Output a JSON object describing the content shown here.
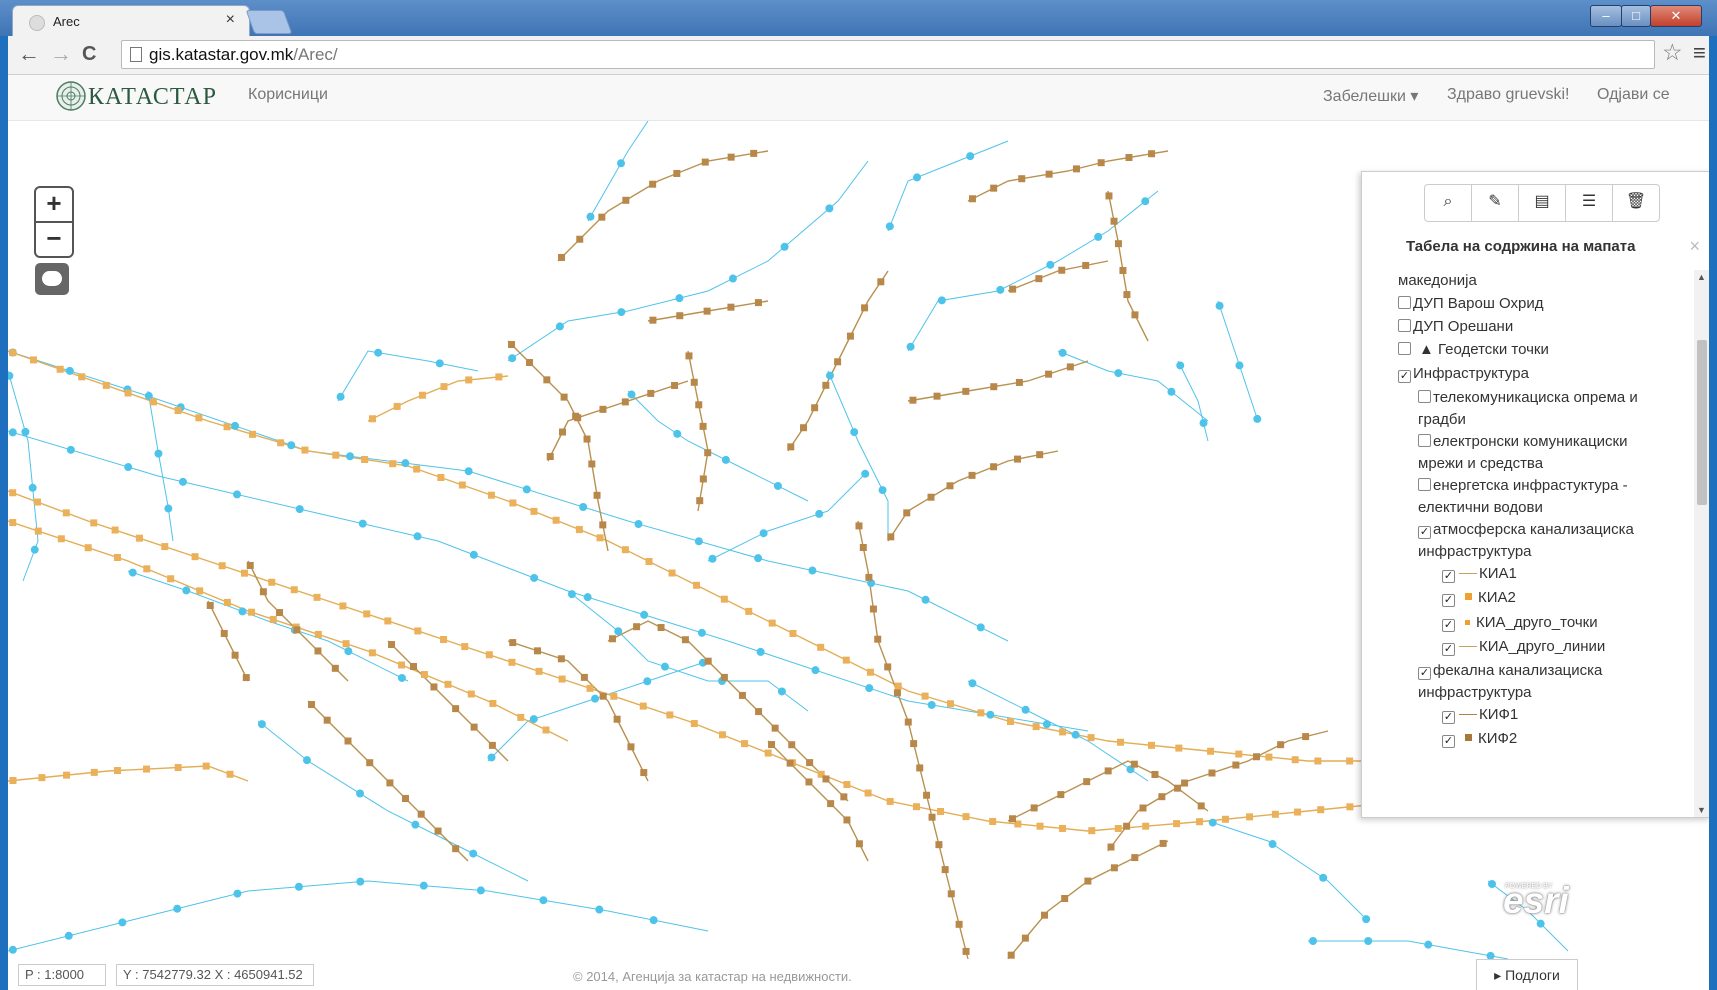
{
  "browser": {
    "tab_title": "Arec",
    "tab_close": "×",
    "url_host": "gis.katastar.gov.mk",
    "url_path": "/Arec/",
    "back": "←",
    "forward": "→",
    "reload": "C",
    "star": "☆",
    "menu": "≡",
    "win_min": "–",
    "win_max": "□",
    "win_close": "✕"
  },
  "navbar": {
    "brand": "КАТАСТАР",
    "users": "Корисници",
    "notes": "Забелешки ▾",
    "hello": "Здраво gruevski!",
    "logout": "Одјави се"
  },
  "zoom": {
    "in": "+",
    "out": "−"
  },
  "toc": {
    "title": "Табела на содржина на мапата",
    "close": "×",
    "buttons": [
      {
        "icon": "search-icon",
        "glyph": "⌕"
      },
      {
        "icon": "pin-icon",
        "glyph": "✎"
      },
      {
        "icon": "legend-icon",
        "glyph": "▤"
      },
      {
        "icon": "list-icon",
        "glyph": "☰"
      },
      {
        "icon": "trash-icon",
        "glyph": "🗑"
      }
    ],
    "items": [
      {
        "label": "македонија",
        "checked": null
      },
      {
        "label": "ДУП Варош Охрид",
        "checked": false
      },
      {
        "label": "ДУП Орешани",
        "checked": false
      },
      {
        "label": "▲ Геодетски точки",
        "checked": false
      },
      {
        "label": "Инфраструктура",
        "checked": true
      },
      {
        "label": "телекомуникациска опрема и",
        "label2": "градби",
        "checked": false
      },
      {
        "label": "електронски комуникациски",
        "label2": "мрежи и средства",
        "checked": false
      },
      {
        "label": "енергетска инфрастуктура -",
        "label2": "електични водови",
        "checked": false
      },
      {
        "label": "атмосферска канализациска",
        "label2": "инфраструктура",
        "checked": true
      },
      {
        "label": "КИА1",
        "checked": true
      },
      {
        "label": "КИА2",
        "checked": true
      },
      {
        "label": "КИА_друго_точки",
        "checked": true
      },
      {
        "label": "КИА_друго_линии",
        "checked": true
      },
      {
        "label": "фекална канализациска",
        "label2": "инфраструктура",
        "checked": true
      },
      {
        "label": "КИФ1",
        "checked": true
      },
      {
        "label": "КИФ2",
        "checked": true
      }
    ]
  },
  "status": {
    "scale": "P : 1:8000",
    "coords": "Y : 7542779.32   X : 4650941.52",
    "copyright": "© 2014, Агенција за катастар на недвижности.",
    "basemaps": "▸ Подлоги"
  },
  "esri": {
    "powered": "POWERED BY",
    "logo": "esri"
  },
  "colors": {
    "water": "#4ec3ea",
    "sewer_light": "#e3ad55",
    "sewer_dark": "#b89150"
  }
}
